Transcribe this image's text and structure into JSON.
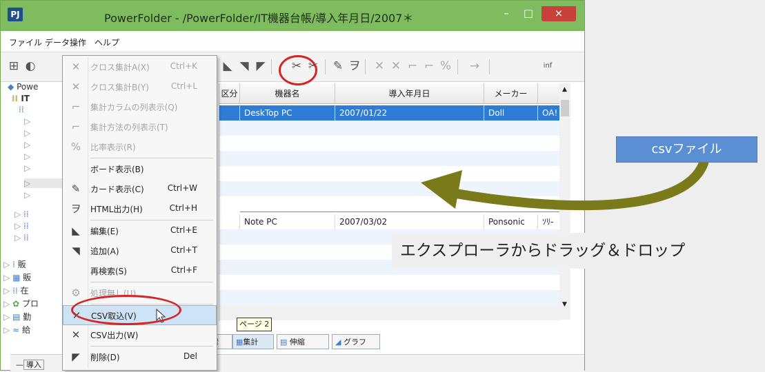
{
  "window": {
    "title": "PowerFolder - /PowerFolder/IT機器台帳/導入年月日/2007＊",
    "app_icon": "PJ",
    "minimize": "–",
    "maximize": "□",
    "close": "×"
  },
  "menubar": [
    "ファイル",
    "データ操作",
    "ヘルプ"
  ],
  "toolbar": {
    "info_label": "inf"
  },
  "tree": {
    "root_label": "Powe",
    "node1": "IT",
    "node_a": "販",
    "node_b": "販",
    "node_c": "在",
    "node_d": "プロ",
    "node_e": "勤",
    "node_f": "給"
  },
  "grid": {
    "headers": [
      "区分",
      "機器名",
      "導入年月日",
      "メーカー",
      ""
    ],
    "rows": [
      {
        "cells": [
          "",
          "DeskTop PC",
          "2007/01/22",
          "Doll",
          "OA!"
        ],
        "selected": true
      },
      {
        "cells": [
          "",
          "Note PC",
          "2007/03/02",
          "Ponsonic",
          "ｿﾘ-"
        ],
        "selected": false
      }
    ]
  },
  "context_menu": {
    "items": [
      {
        "icon": "cross-tab-a-icon",
        "glyph": "✕",
        "label": "クロス集計A(X)",
        "shortcut": "Ctrl+K",
        "disabled": true
      },
      {
        "icon": "cross-tab-b-icon",
        "glyph": "✕",
        "label": "クロス集計B(Y)",
        "shortcut": "Ctrl+L",
        "disabled": true
      },
      {
        "icon": "column-display-icon",
        "glyph": "⌐",
        "label": "集計カラムの列表示(Q)",
        "shortcut": "",
        "disabled": true
      },
      {
        "icon": "method-display-icon",
        "glyph": "⌐",
        "label": "集計方法の列表示(T)",
        "shortcut": "",
        "disabled": true
      },
      {
        "icon": "percent-icon",
        "glyph": "%",
        "label": "比率表示(R)",
        "shortcut": "",
        "disabled": true
      },
      {
        "icon": "",
        "glyph": "",
        "label": "ボード表示(B)",
        "shortcut": "",
        "disabled": false
      },
      {
        "icon": "card-icon",
        "glyph": "✎",
        "label": "カード表示(C)",
        "shortcut": "Ctrl+W",
        "disabled": false
      },
      {
        "icon": "html-icon",
        "glyph": "ヲ",
        "label": "HTML出力(H)",
        "shortcut": "Ctrl+H",
        "disabled": false
      },
      {
        "icon": "edit-icon",
        "glyph": "◣",
        "label": "編集(E)",
        "shortcut": "Ctrl+E",
        "disabled": false
      },
      {
        "icon": "add-icon",
        "glyph": "◥",
        "label": "追加(A)",
        "shortcut": "Ctrl+T",
        "disabled": false
      },
      {
        "icon": "",
        "glyph": "",
        "label": "再検索(S)",
        "shortcut": "Ctrl+F",
        "disabled": false
      },
      {
        "icon": "no-process-icon",
        "glyph": "⚙",
        "label": "処理無し(U)",
        "shortcut": "",
        "disabled": true
      },
      {
        "icon": "csv-import-icon",
        "glyph": "✕",
        "label": "CSV取込(V)",
        "shortcut": "",
        "disabled": false
      },
      {
        "icon": "csv-export-icon",
        "glyph": "✕",
        "label": "CSV出力(W)",
        "shortcut": "",
        "disabled": false
      },
      {
        "icon": "delete-icon",
        "glyph": "◤",
        "label": "削除(D)",
        "shortcut": "Del",
        "disabled": false
      }
    ]
  },
  "bottom_tabs": [
    "索",
    "集計",
    "伸縮",
    "グラフ"
  ],
  "tooltip": "ページ 2",
  "status": {
    "field_label": "導入"
  },
  "annotations": {
    "callout": "csvファイル",
    "caption": "エクスプローラからドラッグ＆ドロップ",
    "arrow_color": "#7a7a1a",
    "highlight_color": "#d62424"
  }
}
